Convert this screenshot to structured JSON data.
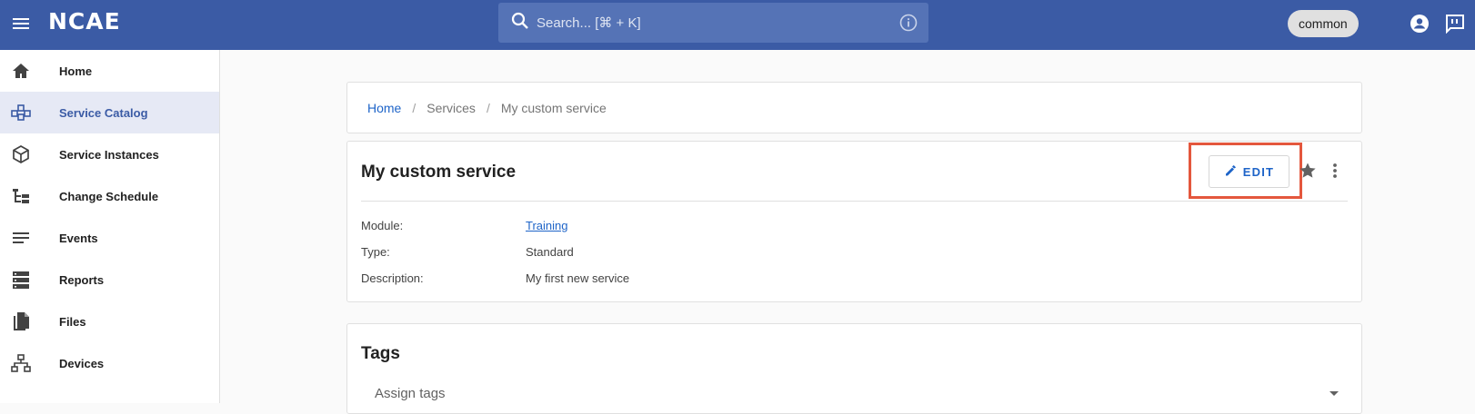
{
  "header": {
    "logo": "NCAE",
    "search_placeholder": "Search... [⌘ + K]",
    "context_chip": "common"
  },
  "sidebar": {
    "items": [
      {
        "label": "Home",
        "icon": "home-icon"
      },
      {
        "label": "Service Catalog",
        "icon": "service-catalog-icon",
        "active": true
      },
      {
        "label": "Service Instances",
        "icon": "cube-icon"
      },
      {
        "label": "Change Schedule",
        "icon": "tree-icon"
      },
      {
        "label": "Events",
        "icon": "lines-icon"
      },
      {
        "label": "Reports",
        "icon": "storage-icon"
      },
      {
        "label": "Files",
        "icon": "file-copy-icon"
      },
      {
        "label": "Devices",
        "icon": "network-icon"
      }
    ]
  },
  "breadcrumb": {
    "home": "Home",
    "services": "Services",
    "current": "My custom service"
  },
  "details": {
    "title": "My custom service",
    "edit_label": "EDIT",
    "fields": [
      {
        "key": "Module:",
        "value": "Training",
        "link": true
      },
      {
        "key": "Type:",
        "value": "Standard"
      },
      {
        "key": "Description:",
        "value": "My first new service"
      }
    ]
  },
  "tags": {
    "title": "Tags",
    "placeholder": "Assign tags"
  },
  "colors": {
    "topbar": "#3b5ba5",
    "accent": "#1e64c8",
    "highlight": "#e4573d"
  }
}
